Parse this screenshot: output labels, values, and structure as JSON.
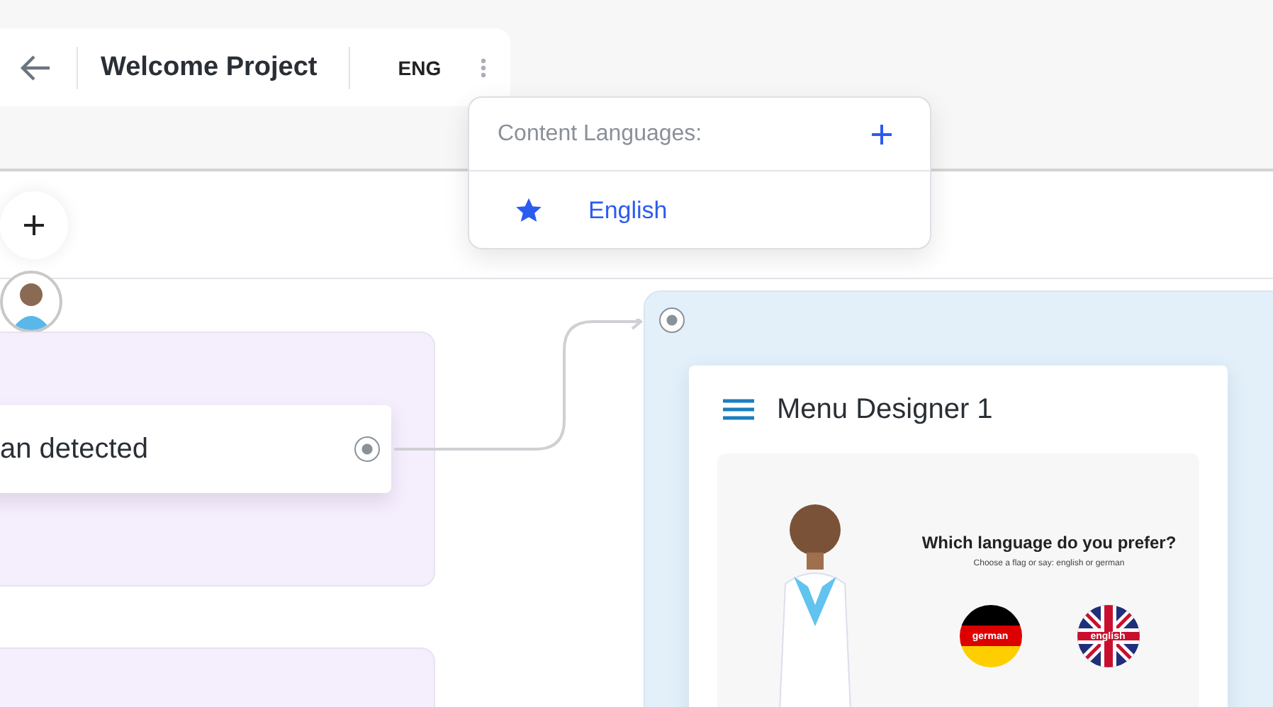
{
  "header": {
    "title": "Welcome Project",
    "language": "ENG"
  },
  "language_menu": {
    "heading": "Content Languages:",
    "languages": [
      {
        "name": "English",
        "default": true
      }
    ]
  },
  "flow": {
    "node_text": "an detected"
  },
  "menu_designer": {
    "title": "Menu Designer 1",
    "preview": {
      "question": "Which language do you prefer?",
      "hint": "Choose a flag or say: english or german",
      "flags": [
        {
          "kind": "de",
          "label": "german"
        },
        {
          "kind": "uk",
          "label": "english"
        }
      ]
    }
  }
}
